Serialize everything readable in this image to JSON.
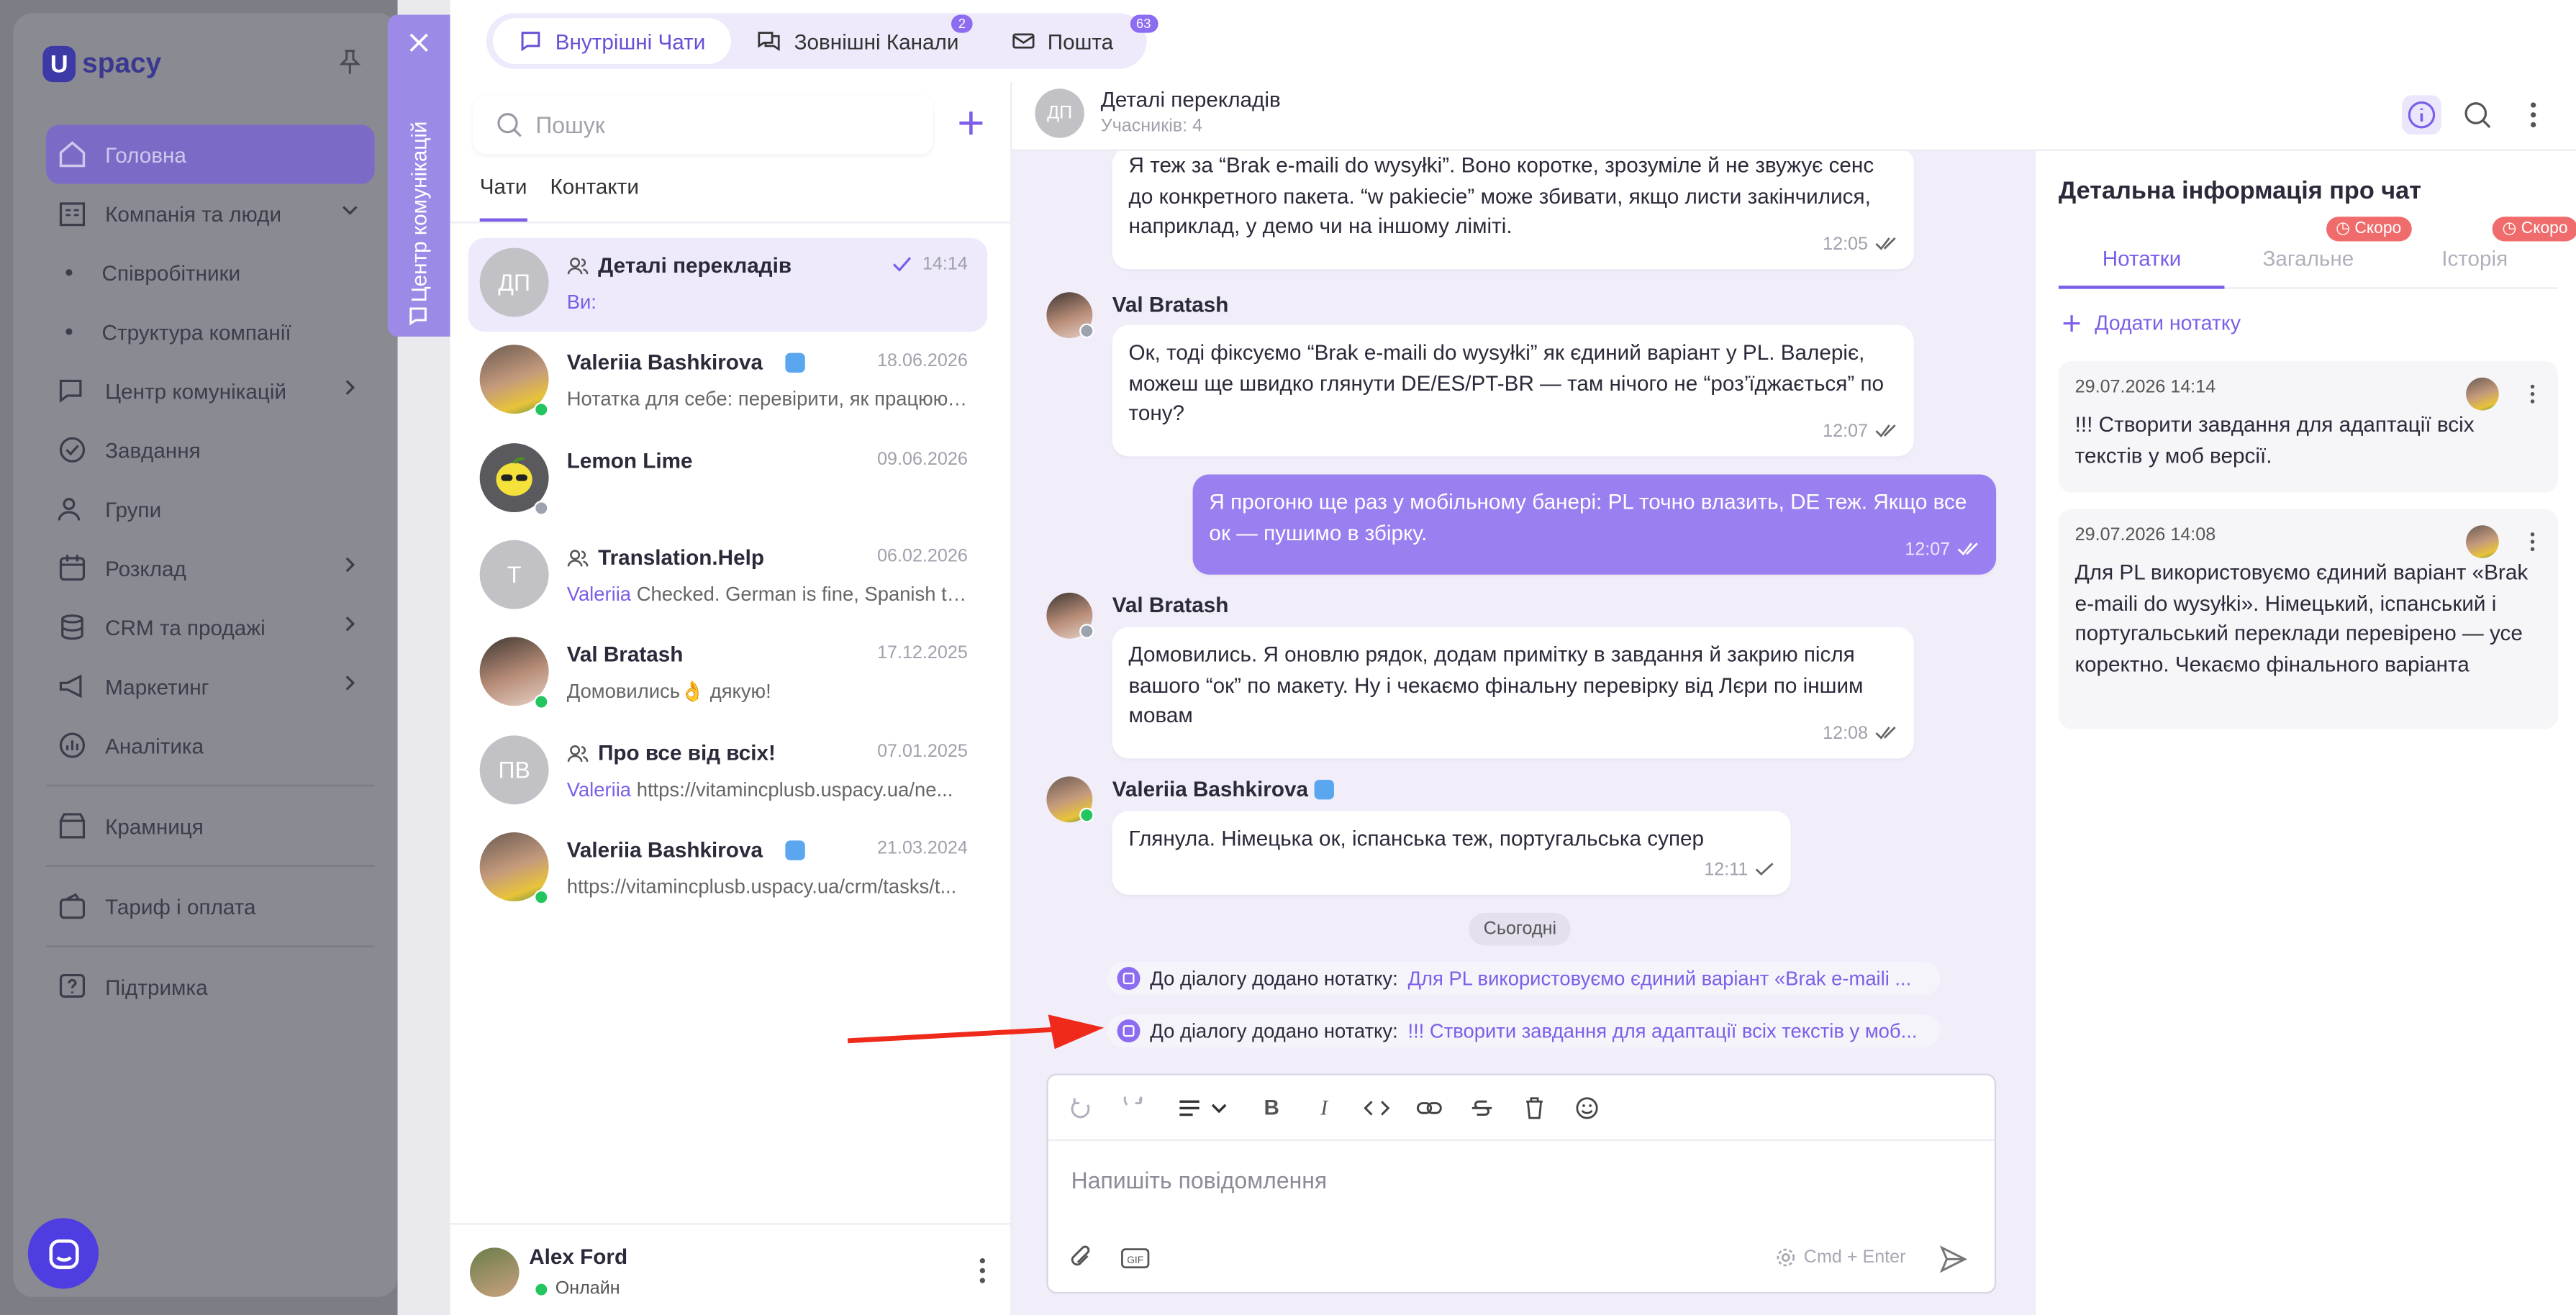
{
  "sidebar": {
    "logo": "spacy",
    "nav": [
      {
        "label": "Головна",
        "active": true
      },
      {
        "label": "Компанія та люди",
        "expanded": true
      },
      {
        "label": "Співробітники",
        "sub": true
      },
      {
        "label": "Структура компанії",
        "sub": true
      },
      {
        "label": "Центр комунікацій"
      },
      {
        "label": "Завдання"
      },
      {
        "label": "Групи"
      },
      {
        "label": "Розклад"
      },
      {
        "label": "CRM та продажі"
      },
      {
        "label": "Маркетинг"
      },
      {
        "label": "Аналітика"
      },
      {
        "label": "Крамниця"
      },
      {
        "label": "Тариф і оплата"
      },
      {
        "label": "Підтримка"
      }
    ]
  },
  "vertical_tab": {
    "label": "Центр комунікацій"
  },
  "channels": {
    "tabs": [
      {
        "label": "Внутрішні Чати",
        "active": true,
        "badge": ""
      },
      {
        "label": "Зовнішні Канали",
        "badge": "2"
      },
      {
        "label": "Пошта",
        "badge": "63"
      }
    ]
  },
  "chatlist": {
    "search_placeholder": "Пошук",
    "tabs": [
      {
        "label": "Чати",
        "active": true
      },
      {
        "label": "Контакти"
      }
    ],
    "items": [
      {
        "initials": "ДП",
        "name": "Деталі перекладів",
        "group": true,
        "date": "14:14",
        "who": "Ви:",
        "preview": "",
        "active": true
      },
      {
        "initials": "",
        "name": "Valeriia Bashkirova",
        "tg": true,
        "date": "18.06.2026",
        "who": "",
        "preview": "Нотатка для себе: перевірити, як працюють..."
      },
      {
        "initials": "",
        "name": "Lemon Lime",
        "date": "09.06.2026",
        "who": "",
        "preview": ""
      },
      {
        "initials": "Т",
        "name": "Translation.Help",
        "group": true,
        "date": "06.02.2026",
        "who": "Valeriia",
        "preview": "Checked. German is fine, Spanish to..."
      },
      {
        "initials": "",
        "name": "Val Bratash",
        "date": "17.12.2025",
        "who": "",
        "preview": "Домовились👌 дякую!"
      },
      {
        "initials": "ПВ",
        "name": "Про все від всіх!",
        "group": true,
        "date": "07.01.2025",
        "who": "Valeriia",
        "preview": "https://vitamincplusb.uspacy.ua/ne..."
      },
      {
        "initials": "",
        "name": "Valeriia Bashkirova",
        "tg": true,
        "date": "21.03.2024",
        "who": "",
        "preview": "https://vitamincplusb.uspacy.ua/crm/tasks/t..."
      }
    ],
    "me": {
      "name": "Alex Ford",
      "status": "Онлайн"
    }
  },
  "conversation": {
    "avatar": "ДП",
    "title": "Деталі перекладів",
    "members": "Учасників: 4",
    "messages": [
      {
        "text": "Я теж за “Brak e-maili do wysyłki”. Воно коротке, зрозуміле й не звужує сенс до конкретного пакета. “w pakiecie” може збивати, якщо листи закінчилися, наприклад, у демо чи на іншому ліміті.",
        "time": "12:05"
      },
      {
        "sender": "Val Bratash",
        "text": "Ок, тоді фіксуємо “Brak e-maili do wysyłki” як єдиний варіант у PL. Валеріє, можеш ще швидко глянути DE/ES/PT-BR — там нічого не “роз’їджається” по тону?",
        "time": "12:07"
      },
      {
        "text": "Я прогоню ще раз у мобільному банері: PL точно влазить, DE теж. Якщо все ок — пушимо в збірку.",
        "time": "12:07",
        "mine": true
      },
      {
        "sender": "Val Bratash",
        "text": "Домовились. Я оновлю рядок, додам примітку в завдання й закрию після вашого “ок” по макету. Ну і чекаємо фінальну перевірку від Лєри по іншим мовам",
        "time": "12:08"
      },
      {
        "sender": "Valeriia Bashkirova",
        "text": "Глянула. Німецька ок, іспанська теж, португальська супер",
        "time": "12:11"
      }
    ],
    "day_chip": "Сьогодні",
    "notes": [
      {
        "label": "До діалогу додано нотатку:",
        "text": "Для PL використовуємо єдиний варіант «Brak e-maili ..."
      },
      {
        "label": "До діалогу додано нотатку:",
        "text": "!!! Створити завдання для адаптації всіх текстів у моб..."
      }
    ],
    "composer": {
      "placeholder": "Напишіть повідомлення",
      "hint": "Cmd + Enter"
    }
  },
  "info": {
    "title": "Детальна інформація про чат",
    "tabs": [
      {
        "label": "Нотатки",
        "active": true
      },
      {
        "label": "Загальне",
        "soon": "Скоро"
      },
      {
        "label": "Історія",
        "soon": "Скоро"
      }
    ],
    "add_note": "Додати нотатку",
    "notes": [
      {
        "date": "29.07.2026 14:14",
        "text": "!!! Створити завдання для адаптації всіх текстів у моб версії."
      },
      {
        "date": "29.07.2026 14:08",
        "text": "Для PL використовуємо єдиний варіант «Brak e-maili do wysyłki». Німецький, іспанський і португальський переклади перевірено — усе коректно. Чекаємо фінального варіанта"
      }
    ]
  },
  "colors": {
    "accent": "#7c5ee8",
    "mine_bubble": "#9a7ff0",
    "online": "#22c55e",
    "soon": "#f06c6c"
  }
}
